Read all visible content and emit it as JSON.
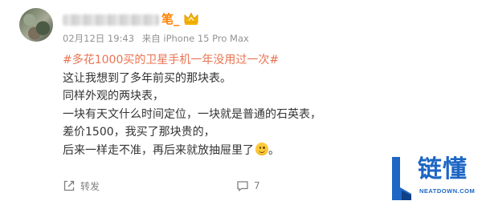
{
  "post": {
    "username_tail": "笔_",
    "date": "02月12日 19:43",
    "source": "来自 iPhone 15 Pro Max",
    "hashtag": "#多花1000买的卫星手机一年没用过一次#",
    "lines": [
      "这让我想到了多年前买的那块表。",
      "同样外观的两块表，",
      "一块有天文什么时间定位，一块就是普通的石英表，",
      "差价1500，我买了那块贵的，",
      "后来一样走不准，再后来就放抽屉里了",
      "。"
    ]
  },
  "actions": {
    "forward_label": "转发",
    "comment_count": "7"
  },
  "watermark": {
    "brand": "链懂",
    "site": "NEATDOWN.COM"
  },
  "colors": {
    "username": "#ff8200",
    "hashtag": "#eb7350",
    "meta": "#939393",
    "brand": "#1d66c4"
  }
}
